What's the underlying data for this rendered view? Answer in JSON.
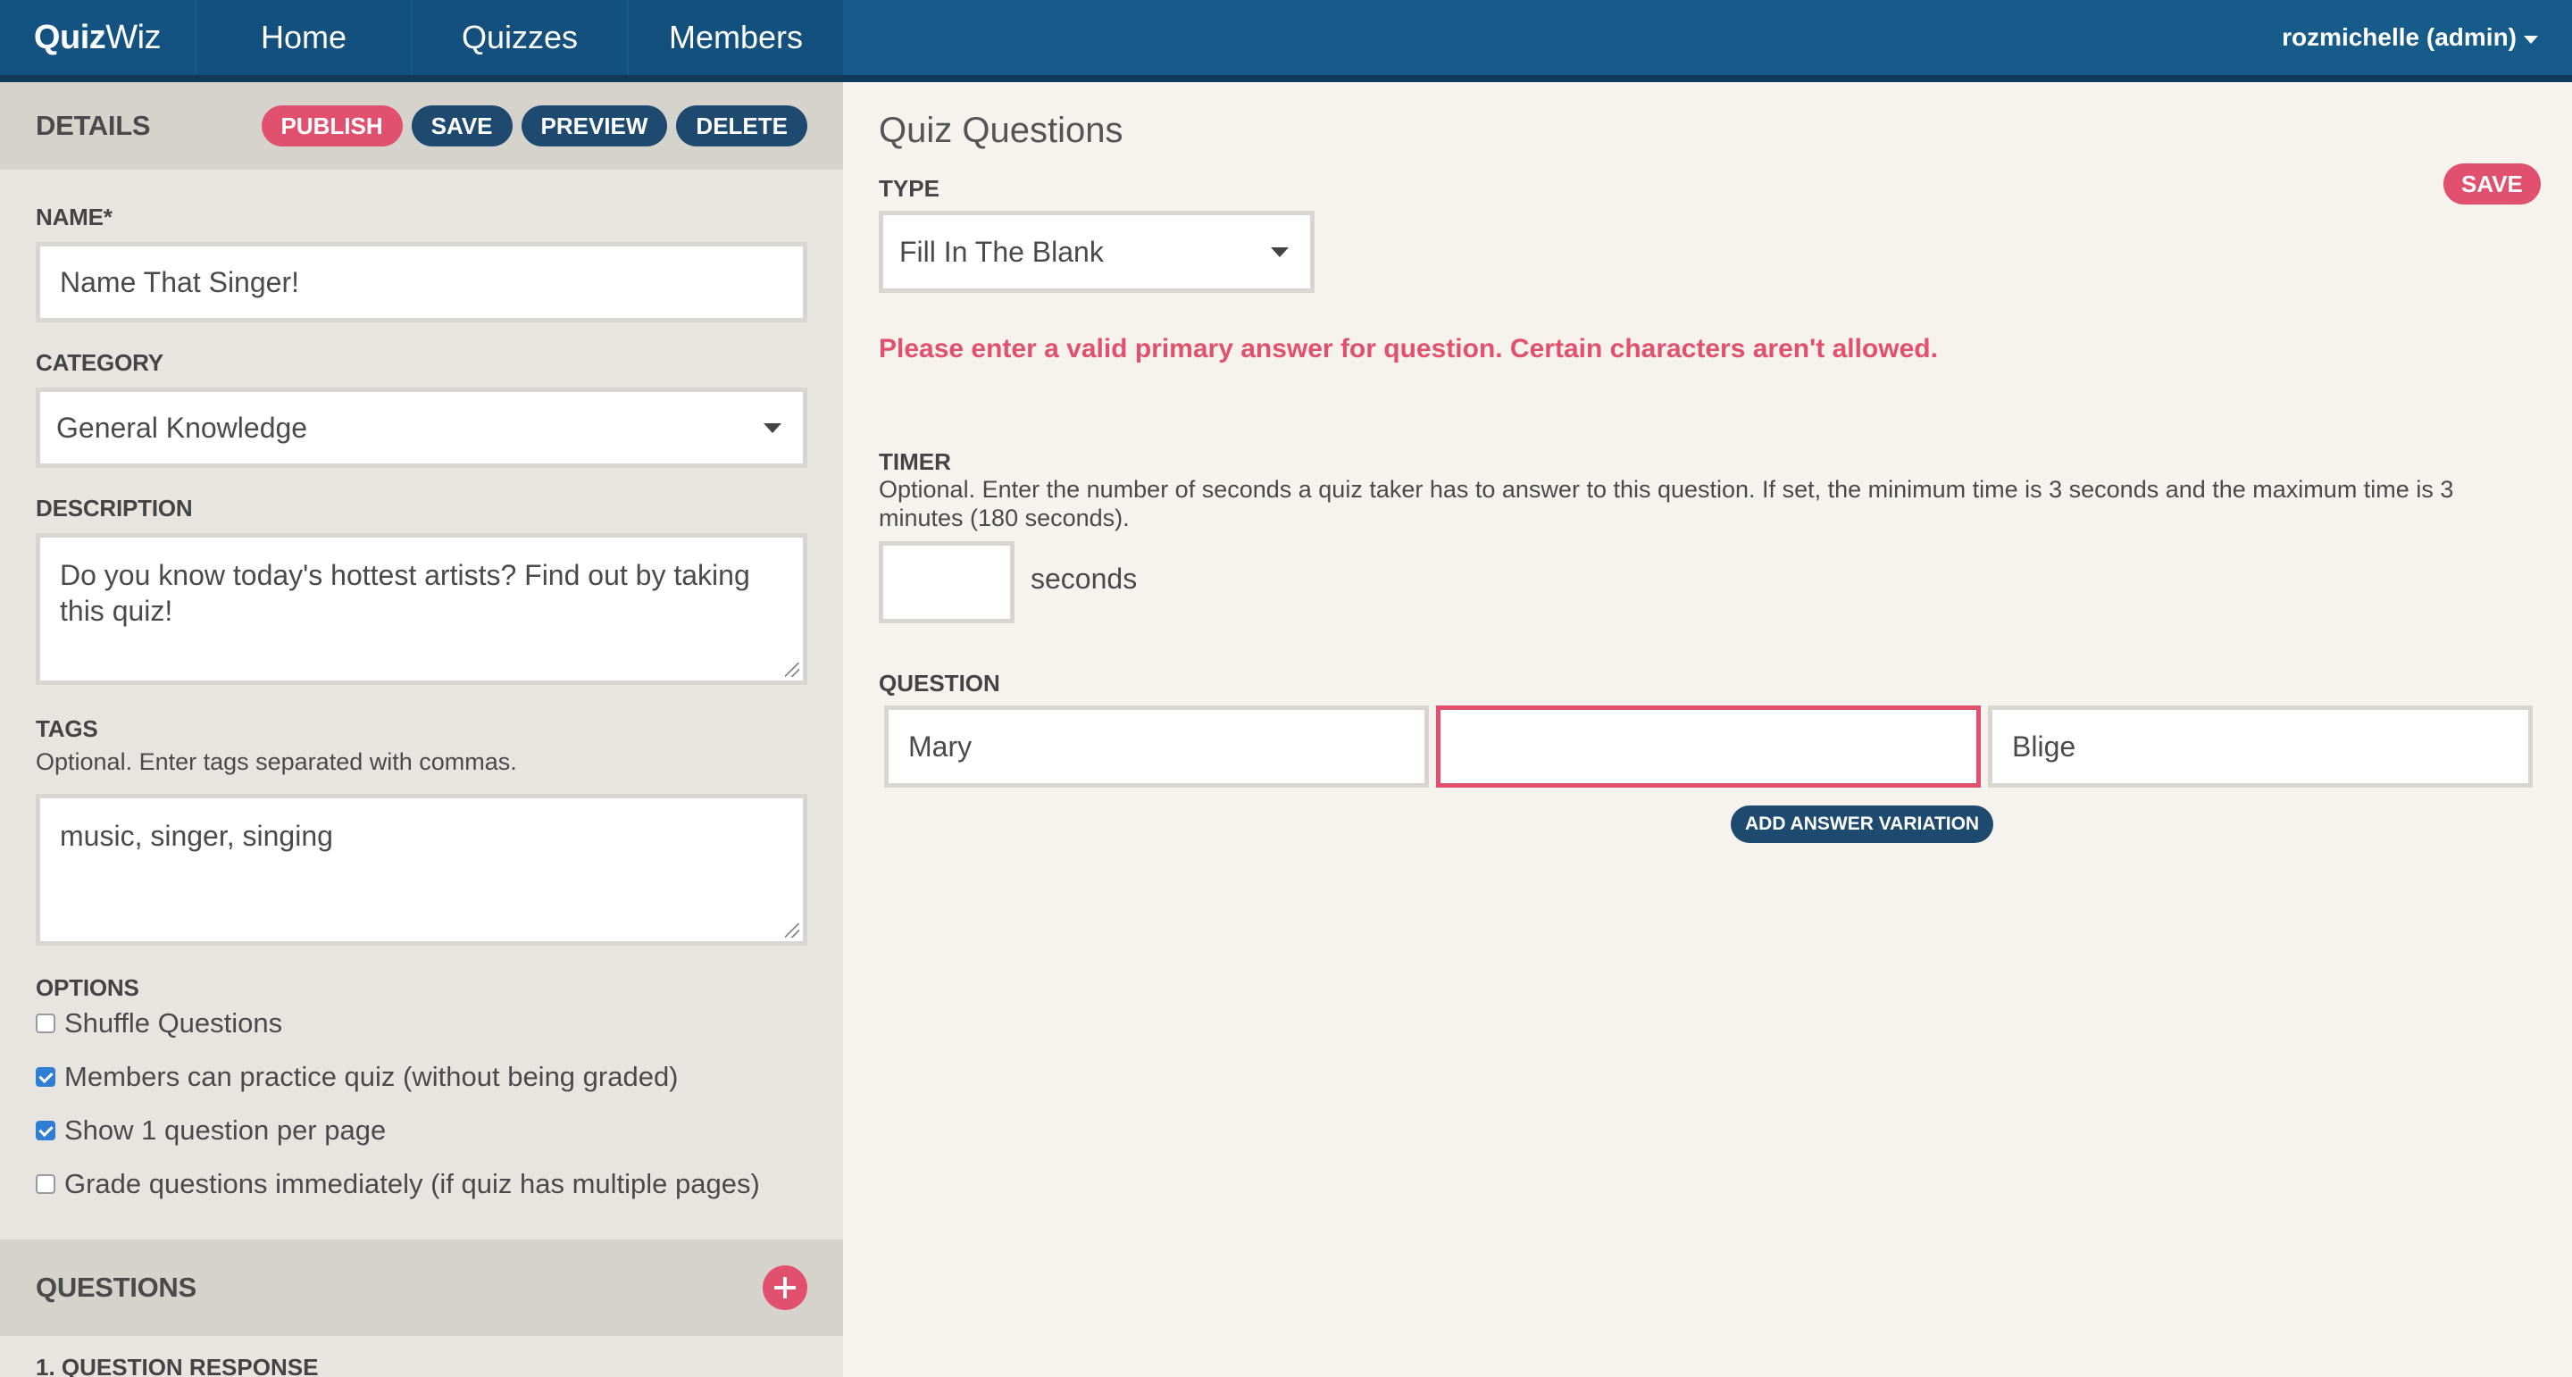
{
  "nav": {
    "brand_bold": "Quiz",
    "brand_light": "Wiz",
    "items": [
      "Home",
      "Quizzes",
      "Members"
    ],
    "user": "rozmichelle (admin)"
  },
  "details": {
    "title": "DETAILS",
    "publish": "PUBLISH",
    "save": "SAVE",
    "preview": "PREVIEW",
    "delete": "DELETE",
    "name_label": "NAME*",
    "name_value": "Name That Singer!",
    "category_label": "CATEGORY",
    "category_value": "General Knowledge",
    "description_label": "DESCRIPTION",
    "description_value": "Do you know today's hottest artists? Find out by taking this quiz!",
    "tags_label": "TAGS",
    "tags_help": "Optional. Enter tags separated with commas.",
    "tags_value": "music, singer, singing",
    "options_label": "OPTIONS",
    "options": [
      {
        "label": "Shuffle Questions",
        "checked": false
      },
      {
        "label": "Members can practice quiz (without being graded)",
        "checked": true
      },
      {
        "label": "Show 1 question per page",
        "checked": true
      },
      {
        "label": "Grade questions immediately (if quiz has multiple pages)",
        "checked": false
      }
    ]
  },
  "questions": {
    "title": "QUESTIONS",
    "first_item": "1. QUESTION RESPONSE"
  },
  "main": {
    "title": "Quiz Questions",
    "save": "SAVE",
    "type_label": "TYPE",
    "type_value": "Fill In The Blank",
    "error": "Please enter a valid primary answer for question. Certain characters aren't allowed.",
    "timer_label": "TIMER",
    "timer_help": "Optional. Enter the number of seconds a quiz taker has to answer to this question. If set, the minimum time is 3 seconds and the maximum time is 3 minutes (180 seconds).",
    "timer_value": "",
    "seconds_label": "seconds",
    "question_label": "QUESTION",
    "answer_parts": [
      "Mary",
      "",
      "Blige"
    ],
    "add_variation": "ADD ANSWER VARIATION"
  },
  "colors": {
    "nav": "#175b8a",
    "accent_pink": "#e2506f",
    "navy_button": "#1f4a70",
    "sidebar": "#e8e5e0",
    "main_bg": "#f6f3ee"
  }
}
